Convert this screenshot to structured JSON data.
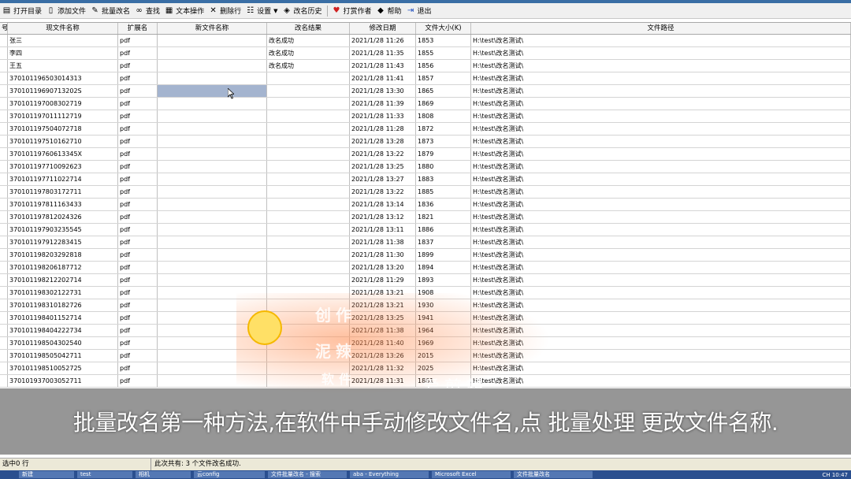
{
  "toolbar": {
    "items": [
      {
        "label": "打开目录",
        "icon": "folder-open-icon"
      },
      {
        "label": "添加文件",
        "icon": "add-file-icon"
      },
      {
        "label": "批量改名",
        "icon": "batch-rename-icon"
      },
      {
        "label": "查找",
        "icon": "binoculars-icon"
      },
      {
        "label": "文本操作",
        "icon": "text-ops-icon"
      },
      {
        "label": "删除行",
        "icon": "delete-row-icon"
      },
      {
        "label": "设置",
        "icon": "settings-icon"
      },
      {
        "label": "改名历史",
        "icon": "history-icon"
      },
      {
        "label": "打赏作者",
        "icon": "heart-icon"
      },
      {
        "label": "帮助",
        "icon": "help-icon"
      },
      {
        "label": "退出",
        "icon": "exit-icon"
      }
    ]
  },
  "table": {
    "headers": [
      "号",
      "现文件名称",
      "扩展名",
      "新文件名称",
      "改名结果",
      "修改日期",
      "文件大小(K)",
      "文件路径"
    ],
    "rows": [
      [
        "",
        "张三",
        "pdf",
        "",
        "改名成功",
        "2021/1/28 11:26",
        "1853",
        "H:\\test\\改名测试\\"
      ],
      [
        "",
        "李四",
        "pdf",
        "",
        "改名成功",
        "2021/1/28 11:35",
        "1855",
        "H:\\test\\改名测试\\"
      ],
      [
        "",
        "王五",
        "pdf",
        "",
        "改名成功",
        "2021/1/28 11:43",
        "1856",
        "H:\\test\\改名测试\\"
      ],
      [
        "",
        "370101196503014313",
        "pdf",
        "",
        "",
        "2021/1/28 11:41",
        "1857",
        "H:\\test\\改名测试\\"
      ],
      [
        "",
        "37010119690713202S",
        "pdf",
        "",
        "",
        "2021/1/28 13:30",
        "1865",
        "H:\\test\\改名测试\\"
      ],
      [
        "",
        "370101197008302719",
        "pdf",
        "",
        "",
        "2021/1/28 11:39",
        "1869",
        "H:\\test\\改名测试\\"
      ],
      [
        "",
        "370101197011112719",
        "pdf",
        "",
        "",
        "2021/1/28 11:33",
        "1808",
        "H:\\test\\改名测试\\"
      ],
      [
        "",
        "370101197504072718",
        "pdf",
        "",
        "",
        "2021/1/28 11:28",
        "1872",
        "H:\\test\\改名测试\\"
      ],
      [
        "",
        "370101197510162710",
        "pdf",
        "",
        "",
        "2021/1/28 13:28",
        "1873",
        "H:\\test\\改名测试\\"
      ],
      [
        "",
        "37010119760613345X",
        "pdf",
        "",
        "",
        "2021/1/28 13:22",
        "1879",
        "H:\\test\\改名测试\\"
      ],
      [
        "",
        "370101197710092623",
        "pdf",
        "",
        "",
        "2021/1/28 13:25",
        "1880",
        "H:\\test\\改名测试\\"
      ],
      [
        "",
        "370101197711022714",
        "pdf",
        "",
        "",
        "2021/1/28 13:27",
        "1883",
        "H:\\test\\改名测试\\"
      ],
      [
        "",
        "370101197803172711",
        "pdf",
        "",
        "",
        "2021/1/28 13:22",
        "1885",
        "H:\\test\\改名测试\\"
      ],
      [
        "",
        "370101197811163433",
        "pdf",
        "",
        "",
        "2021/1/28 13:14",
        "1836",
        "H:\\test\\改名测试\\"
      ],
      [
        "",
        "370101197812024326",
        "pdf",
        "",
        "",
        "2021/1/28 13:12",
        "1821",
        "H:\\test\\改名测试\\"
      ],
      [
        "",
        "370101197903235545",
        "pdf",
        "",
        "",
        "2021/1/28 13:11",
        "1886",
        "H:\\test\\改名测试\\"
      ],
      [
        "",
        "370101197912283415",
        "pdf",
        "",
        "",
        "2021/1/28 11:38",
        "1837",
        "H:\\test\\改名测试\\"
      ],
      [
        "",
        "370101198203292818",
        "pdf",
        "",
        "",
        "2021/1/28 11:30",
        "1899",
        "H:\\test\\改名测试\\"
      ],
      [
        "",
        "370101198206187712",
        "pdf",
        "",
        "",
        "2021/1/28 13:20",
        "1894",
        "H:\\test\\改名测试\\"
      ],
      [
        "",
        "370101198212202714",
        "pdf",
        "",
        "",
        "2021/1/28 11:29",
        "1893",
        "H:\\test\\改名测试\\"
      ],
      [
        "",
        "370101198302122731",
        "pdf",
        "",
        "",
        "2021/1/28 13:21",
        "1908",
        "H:\\test\\改名测试\\"
      ],
      [
        "",
        "370101198310182726",
        "pdf",
        "",
        "",
        "2021/1/28 13:21",
        "1930",
        "H:\\test\\改名测试\\"
      ],
      [
        "",
        "370101198401152714",
        "pdf",
        "",
        "",
        "2021/1/28 13:25",
        "1941",
        "H:\\test\\改名测试\\"
      ],
      [
        "",
        "370101198404222734",
        "pdf",
        "",
        "",
        "2021/1/28 11:38",
        "1964",
        "H:\\test\\改名测试\\"
      ],
      [
        "",
        "370101198504302540",
        "pdf",
        "",
        "",
        "2021/1/28 11:40",
        "1969",
        "H:\\test\\改名测试\\"
      ],
      [
        "",
        "370101198505042711",
        "pdf",
        "",
        "",
        "2021/1/28 13:26",
        "2015",
        "H:\\test\\改名测试\\"
      ],
      [
        "",
        "370101198510052725",
        "pdf",
        "",
        "",
        "2021/1/28 11:32",
        "2025",
        "H:\\test\\改名测试\\"
      ],
      [
        "",
        "370101937003052711",
        "pdf",
        "",
        "",
        "2021/1/28 11:31",
        "1861",
        "H:\\test\\改名测试\\"
      ]
    ]
  },
  "subtitle": "批量改名第一种方法,在软件中手动修改文件名,点 批量处理 更改文件名称.",
  "watermark": {
    "line1": "创作",
    "line2": "泥辣",
    "line3": "软件",
    "brand": "爱剪辑"
  },
  "statusbar": {
    "left": "选中0 行",
    "right": "此次共有: 3 个文件改名成功."
  },
  "taskbar": {
    "items": [
      "新建",
      "test",
      "相机",
      "云config",
      "文件批量改名 - 搜索",
      "aba - Everything",
      "Microsoft Excel",
      "文件批量改名"
    ],
    "tray": "CH  10:47"
  },
  "colors": {
    "selected_cell": "#a4b4cf",
    "subtitle_band": "#6e6e6e"
  }
}
